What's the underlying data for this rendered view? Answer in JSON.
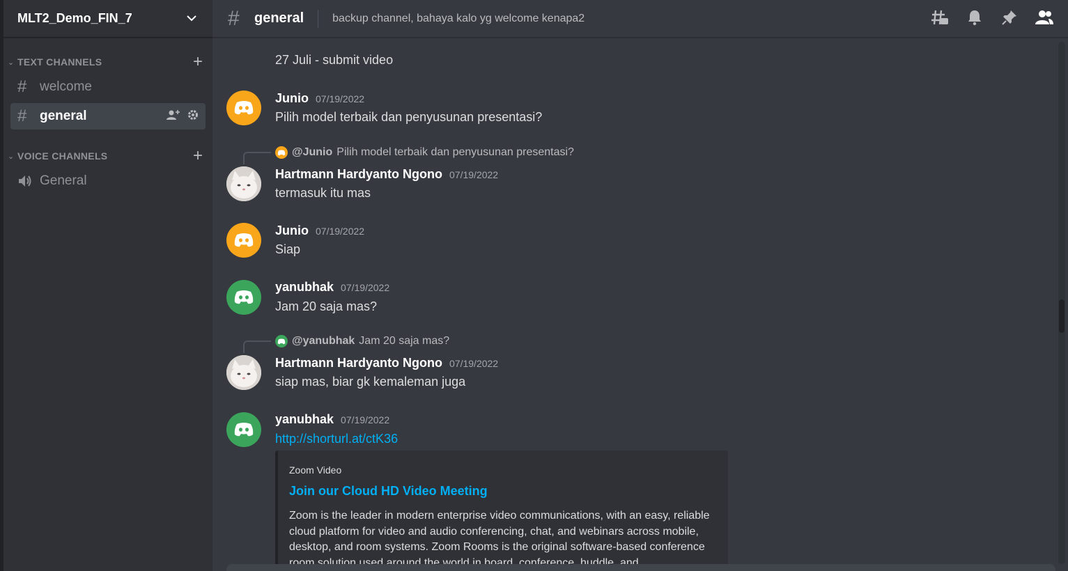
{
  "server": {
    "name": "MLT2_Demo_FIN_7"
  },
  "sidebar": {
    "text_category": "TEXT CHANNELS",
    "voice_category": "VOICE CHANNELS",
    "text_channels": [
      {
        "label": "welcome"
      },
      {
        "label": "general"
      }
    ],
    "voice_channels": [
      {
        "label": "General"
      }
    ]
  },
  "header": {
    "channel": "general",
    "topic": "backup channel, bahaya kalo yg welcome kenapa2"
  },
  "messages": [
    {
      "text": "27 Juli - submit video"
    },
    {
      "user": "Junio",
      "time": "07/19/2022",
      "text": "Pilih model terbaik dan penyusunan presentasi?"
    },
    {
      "reply_user": "@Junio",
      "reply_text": "Pilih model terbaik dan penyusunan presentasi?",
      "user": "Hartmann Hardyanto Ngono",
      "time": "07/19/2022",
      "text": "termasuk itu mas"
    },
    {
      "user": "Junio",
      "time": "07/19/2022",
      "text": "Siap"
    },
    {
      "user": "yanubhak",
      "time": "07/19/2022",
      "text": "Jam 20 saja mas?"
    },
    {
      "reply_user": "@yanubhak",
      "reply_text": "Jam 20 saja mas?",
      "user": "Hartmann Hardyanto Ngono",
      "time": "07/19/2022",
      "text": "siap mas, biar gk kemaleman juga"
    },
    {
      "user": "yanubhak",
      "time": "07/19/2022",
      "text": "http://shorturl.at/ctK36",
      "embed": {
        "provider": "Zoom Video",
        "title": "Join our Cloud HD Video Meeting",
        "description": "Zoom is the leader in modern enterprise video communications, with an easy, reliable cloud platform for video and audio conferencing, chat, and webinars across mobile, desktop, and room systems. Zoom Rooms is the original software-based conference room solution used around the world in board, conference, huddle, and"
      }
    }
  ],
  "icons": {
    "threads": "threads-icon",
    "bell": "bell-icon",
    "pin": "pin-icon",
    "members": "members-icon",
    "discord": "discord-logo-icon"
  },
  "colors": {
    "orange_avatar": "#faa61a",
    "green_avatar": "#3ba55c",
    "link": "#00aff4"
  }
}
